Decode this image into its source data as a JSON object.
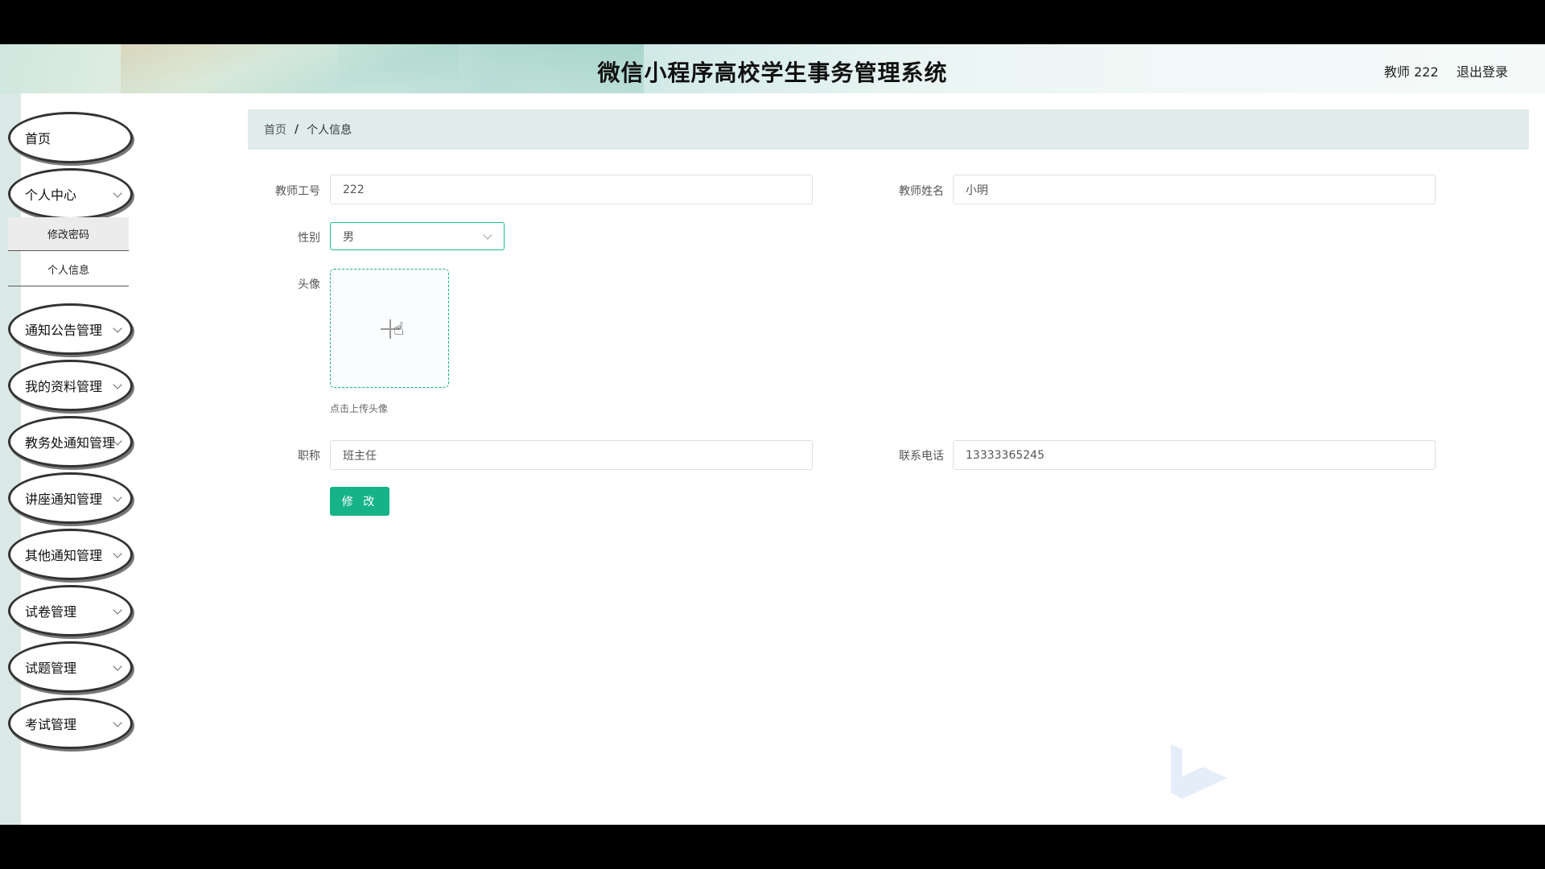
{
  "header": {
    "title": "微信小程序高校学生事务管理系统",
    "user": "教师 222",
    "logout": "退出登录"
  },
  "sidebar": {
    "items": [
      {
        "label": "首页"
      },
      {
        "label": "个人中心"
      },
      {
        "label": "通知公告管理"
      },
      {
        "label": "我的资料管理"
      },
      {
        "label": "教务处通知管理"
      },
      {
        "label": "讲座通知管理"
      },
      {
        "label": "其他通知管理"
      },
      {
        "label": "试卷管理"
      },
      {
        "label": "试题管理"
      },
      {
        "label": "考试管理"
      }
    ],
    "submenu": [
      {
        "label": "修改密码"
      },
      {
        "label": "个人信息"
      }
    ]
  },
  "breadcrumb": {
    "home": "首页",
    "sep": "/",
    "current": "个人信息"
  },
  "form": {
    "teacher_id": {
      "label": "教师工号",
      "value": "222"
    },
    "teacher_name": {
      "label": "教师姓名",
      "value": "小明"
    },
    "gender": {
      "label": "性别",
      "value": "男"
    },
    "avatar": {
      "label": "头像",
      "hint": "点击上传头像"
    },
    "title": {
      "label": "职称",
      "value": "班主任"
    },
    "phone": {
      "label": "联系电话",
      "value": "13333365245"
    },
    "submit": "修 改"
  },
  "colors": {
    "accent": "#16b388",
    "header_bg": "#d6ece9",
    "breadcrumb_bg": "#dfeceb"
  }
}
